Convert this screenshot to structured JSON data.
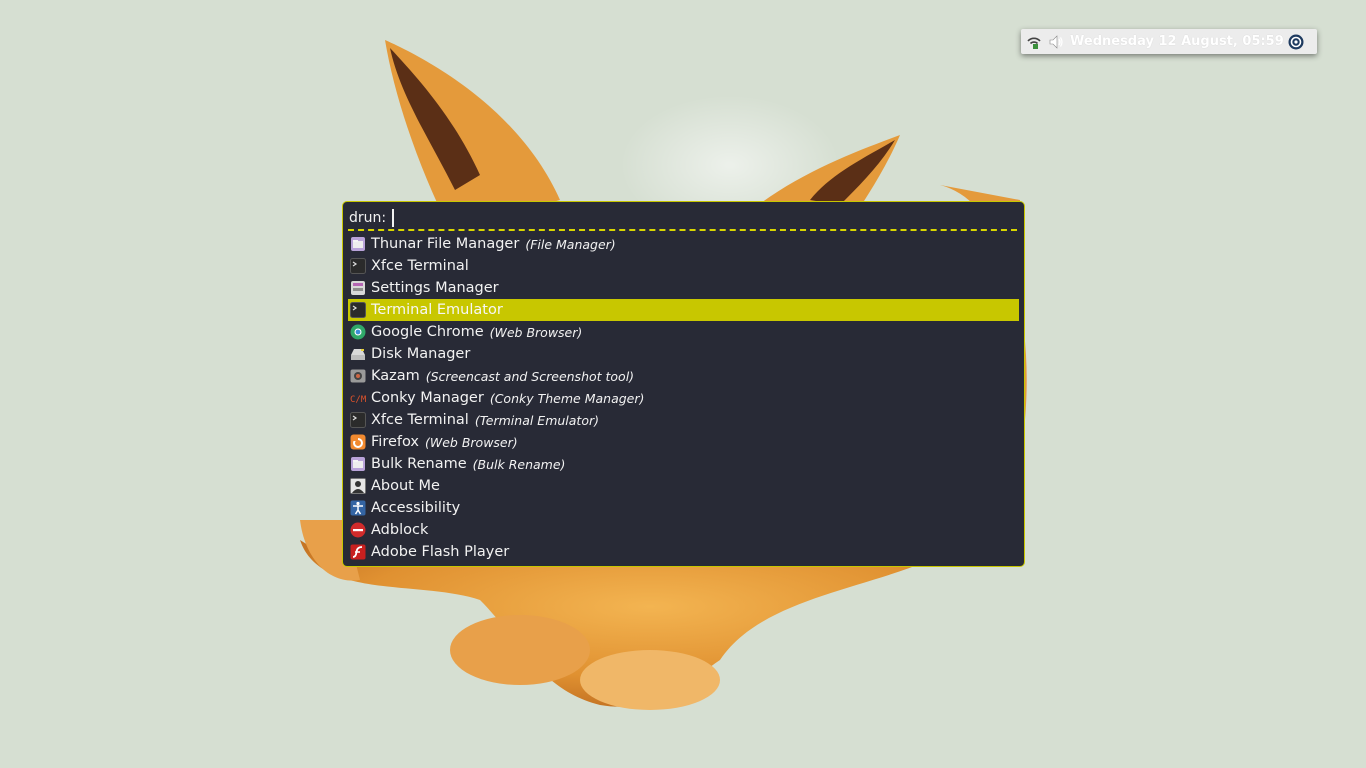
{
  "panel": {
    "clock": "Wednesday 12 August, 05:59",
    "icons": [
      "network-icon",
      "volume-icon",
      "power-icon"
    ]
  },
  "launcher": {
    "prompt": "drun:",
    "input_value": "",
    "accent_color": "#c8c700",
    "background_color": "#282a36",
    "items": [
      {
        "label": "Thunar File Manager",
        "sub": "(File Manager)",
        "icon": "folder-icon"
      },
      {
        "label": "Xfce Terminal",
        "sub": "",
        "icon": "terminal-icon"
      },
      {
        "label": "Settings Manager",
        "sub": "",
        "icon": "settings-icon"
      },
      {
        "label": "Terminal Emulator",
        "sub": "",
        "icon": "terminal-icon",
        "selected": true
      },
      {
        "label": "Google Chrome",
        "sub": "(Web Browser)",
        "icon": "chrome-icon"
      },
      {
        "label": "Disk Manager",
        "sub": "",
        "icon": "disk-icon"
      },
      {
        "label": "Kazam",
        "sub": "(Screencast and Screenshot tool)",
        "icon": "camera-icon"
      },
      {
        "label": "Conky Manager",
        "sub": "(Conky Theme Manager)",
        "icon": "conky-icon"
      },
      {
        "label": "Xfce Terminal",
        "sub": "(Terminal Emulator)",
        "icon": "terminal-icon"
      },
      {
        "label": "Firefox",
        "sub": "(Web Browser)",
        "icon": "firefox-icon"
      },
      {
        "label": "Bulk Rename",
        "sub": "(Bulk Rename)",
        "icon": "folder-icon"
      },
      {
        "label": "About Me",
        "sub": "",
        "icon": "user-icon"
      },
      {
        "label": "Accessibility",
        "sub": "",
        "icon": "accessibility-icon"
      },
      {
        "label": "Adblock",
        "sub": "",
        "icon": "adblock-icon"
      },
      {
        "label": "Adobe Flash Player",
        "sub": "",
        "icon": "flash-icon"
      }
    ]
  }
}
